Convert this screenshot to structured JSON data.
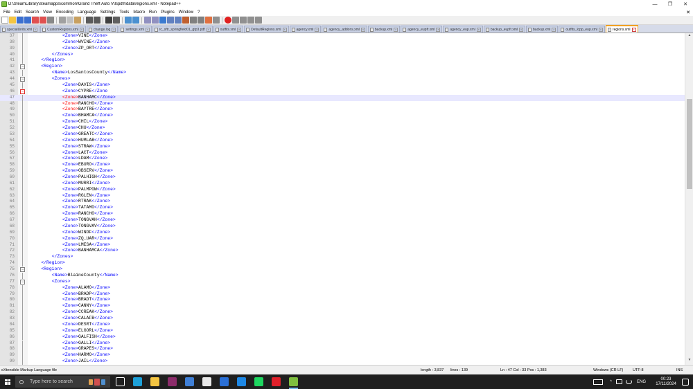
{
  "window": {
    "title": "D:\\SteamLibrary\\steamapps\\common\\Grand Theft Auto V\\lspdfr\\data\\regions.xml - Notepad++",
    "controls": [
      "—",
      "❐",
      "✕"
    ]
  },
  "menu": [
    "File",
    "Edit",
    "Search",
    "View",
    "Encoding",
    "Language",
    "Settings",
    "Tools",
    "Macro",
    "Run",
    "Plugins",
    "Window",
    "?"
  ],
  "menu_close": "✕",
  "tabs": [
    {
      "label": "specialUnits.xml",
      "active": false
    },
    {
      "label": "CustomRegions.xml",
      "active": false
    },
    {
      "label": "change.log",
      "active": false
    },
    {
      "label": "settings.xml",
      "active": false
    },
    {
      "label": "rc_sftr_springfield01_gtp3.pdf",
      "active": false
    },
    {
      "label": "outfits.xml",
      "active": false
    },
    {
      "label": "DefaultRegions.xml",
      "active": false
    },
    {
      "label": "agency.xml",
      "active": false
    },
    {
      "label": "agency_addons.xml",
      "active": false
    },
    {
      "label": "backup.xml",
      "active": false
    },
    {
      "label": "agency_eupfr.xml",
      "active": false
    },
    {
      "label": "agency_eup.xml",
      "active": false
    },
    {
      "label": "backup_eupfr.xml",
      "active": false
    },
    {
      "label": "backup.xml",
      "active": false
    },
    {
      "label": "outfits_lcpp_eup.xml",
      "active": false
    },
    {
      "label": "regions.xml",
      "active": true
    }
  ],
  "editor": {
    "current_line": 47,
    "lines": [
      {
        "n": 37,
        "indent": 6,
        "kind": "zone",
        "value": "VINE"
      },
      {
        "n": 38,
        "indent": 6,
        "kind": "zone",
        "value": "WVINE"
      },
      {
        "n": 39,
        "indent": 6,
        "kind": "zone",
        "value": "ZP_ORT"
      },
      {
        "n": 40,
        "indent": 4,
        "kind": "close",
        "value": "</Zones>"
      },
      {
        "n": 41,
        "indent": 2,
        "kind": "close",
        "value": "</Region>"
      },
      {
        "n": 42,
        "indent": 2,
        "kind": "open",
        "value": "<Region>"
      },
      {
        "n": 43,
        "indent": 4,
        "kind": "name",
        "value": "LosSantosCounty"
      },
      {
        "n": 44,
        "indent": 4,
        "kind": "open",
        "value": "<Zones>"
      },
      {
        "n": 45,
        "indent": 6,
        "kind": "zone",
        "value": "DAVIS"
      },
      {
        "n": 46,
        "indent": 6,
        "kind": "zonebroken",
        "value": "CYPRE"
      },
      {
        "n": 47,
        "indent": 6,
        "kind": "zonesel",
        "value": "BANHAMC"
      },
      {
        "n": 48,
        "indent": 6,
        "kind": "zonered",
        "value": "RANCHO"
      },
      {
        "n": 49,
        "indent": 6,
        "kind": "zonered",
        "value": "BAYTRE"
      },
      {
        "n": 50,
        "indent": 6,
        "kind": "zone",
        "value": "BHAMCA"
      },
      {
        "n": 51,
        "indent": 6,
        "kind": "zone",
        "value": "CHIL"
      },
      {
        "n": 52,
        "indent": 6,
        "kind": "zone",
        "value": "CHU"
      },
      {
        "n": 53,
        "indent": 6,
        "kind": "zone",
        "value": "GREATC"
      },
      {
        "n": 54,
        "indent": 6,
        "kind": "zone",
        "value": "HUMLAB"
      },
      {
        "n": 55,
        "indent": 6,
        "kind": "zone",
        "value": "STRAW"
      },
      {
        "n": 56,
        "indent": 6,
        "kind": "zone",
        "value": "LACT"
      },
      {
        "n": 57,
        "indent": 6,
        "kind": "zone",
        "value": "LDAM"
      },
      {
        "n": 58,
        "indent": 6,
        "kind": "zone",
        "value": "EBURO"
      },
      {
        "n": 59,
        "indent": 6,
        "kind": "zone",
        "value": "OBSERV"
      },
      {
        "n": 60,
        "indent": 6,
        "kind": "zone",
        "value": "PALHIGH"
      },
      {
        "n": 61,
        "indent": 6,
        "kind": "zone",
        "value": "MURRI"
      },
      {
        "n": 62,
        "indent": 6,
        "kind": "zone",
        "value": "PALMPOW"
      },
      {
        "n": 63,
        "indent": 6,
        "kind": "zone",
        "value": "RGLEN"
      },
      {
        "n": 64,
        "indent": 6,
        "kind": "zone",
        "value": "RTRAK"
      },
      {
        "n": 65,
        "indent": 6,
        "kind": "zone",
        "value": "TATAMO"
      },
      {
        "n": 66,
        "indent": 6,
        "kind": "zone",
        "value": "RANCHO"
      },
      {
        "n": 67,
        "indent": 6,
        "kind": "zone",
        "value": "TONGVAH"
      },
      {
        "n": 68,
        "indent": 6,
        "kind": "zone",
        "value": "TONGVAV"
      },
      {
        "n": 69,
        "indent": 6,
        "kind": "zone",
        "value": "WINDF"
      },
      {
        "n": 70,
        "indent": 6,
        "kind": "zone",
        "value": "ZQ_UAR"
      },
      {
        "n": 71,
        "indent": 6,
        "kind": "zone",
        "value": "LMESA"
      },
      {
        "n": 72,
        "indent": 6,
        "kind": "zone",
        "value": "BANHAMCA"
      },
      {
        "n": 73,
        "indent": 4,
        "kind": "close",
        "value": "</Zones>"
      },
      {
        "n": 74,
        "indent": 2,
        "kind": "close",
        "value": "</Region>"
      },
      {
        "n": 75,
        "indent": 2,
        "kind": "open",
        "value": "<Region>"
      },
      {
        "n": 76,
        "indent": 4,
        "kind": "name",
        "value": "BlaineCounty"
      },
      {
        "n": 77,
        "indent": 4,
        "kind": "open",
        "value": "<Zones>"
      },
      {
        "n": 78,
        "indent": 6,
        "kind": "zone",
        "value": "ALAMO"
      },
      {
        "n": 79,
        "indent": 6,
        "kind": "zone",
        "value": "BRADP"
      },
      {
        "n": 80,
        "indent": 6,
        "kind": "zone",
        "value": "BRADT"
      },
      {
        "n": 81,
        "indent": 6,
        "kind": "zone",
        "value": "CANNY"
      },
      {
        "n": 82,
        "indent": 6,
        "kind": "zone",
        "value": "CCREAK"
      },
      {
        "n": 83,
        "indent": 6,
        "kind": "zone",
        "value": "CALAFB"
      },
      {
        "n": 84,
        "indent": 6,
        "kind": "zone",
        "value": "DESRT"
      },
      {
        "n": 85,
        "indent": 6,
        "kind": "zone",
        "value": "ELGORL"
      },
      {
        "n": 86,
        "indent": 6,
        "kind": "zone",
        "value": "GALFISH"
      },
      {
        "n": 87,
        "indent": 6,
        "kind": "zone",
        "value": "GALLI"
      },
      {
        "n": 88,
        "indent": 6,
        "kind": "zone",
        "value": "GRAPES"
      },
      {
        "n": 89,
        "indent": 6,
        "kind": "zone",
        "value": "HARMO"
      },
      {
        "n": 90,
        "indent": 6,
        "kind": "zone",
        "value": "JAIL"
      }
    ]
  },
  "status": {
    "file_type": "eXtensible Markup Language file",
    "length": "length : 3,837",
    "lines": "lines : 139",
    "position": "Ln : 47    Col : 33    Pos : 1,383",
    "eol": "Windows (CR LF)",
    "encoding": "UTF-8",
    "mode": "INS"
  },
  "taskbar": {
    "search_placeholder": "Type here to search",
    "language": "ENG",
    "time": "00:23",
    "date": "17/11/2024",
    "tray_chevron": "^",
    "apps": [
      {
        "name": "task-view-icon",
        "color": "#1f1f1f",
        "active": false
      },
      {
        "name": "edge-icon",
        "color": "#1da0d8",
        "active": false
      },
      {
        "name": "file-explorer-icon",
        "color": "#f4c542",
        "active": false
      },
      {
        "name": "winrar-icon",
        "color": "#8c2c6b",
        "active": false
      },
      {
        "name": "store-icon",
        "color": "#3f7fd6",
        "active": false
      },
      {
        "name": "notepad-icon",
        "color": "#e8e8e8",
        "active": false
      },
      {
        "name": "rockstar-launcher-icon",
        "color": "#2a6fd6",
        "active": false
      },
      {
        "name": "calculator-icon",
        "color": "#1e88e5",
        "active": false
      },
      {
        "name": "spotify-icon",
        "color": "#1ed760",
        "active": false
      },
      {
        "name": "opera-icon",
        "color": "#e0202a",
        "active": false
      },
      {
        "name": "notepadpp-icon",
        "color": "#7fbf3f",
        "active": true
      }
    ]
  }
}
